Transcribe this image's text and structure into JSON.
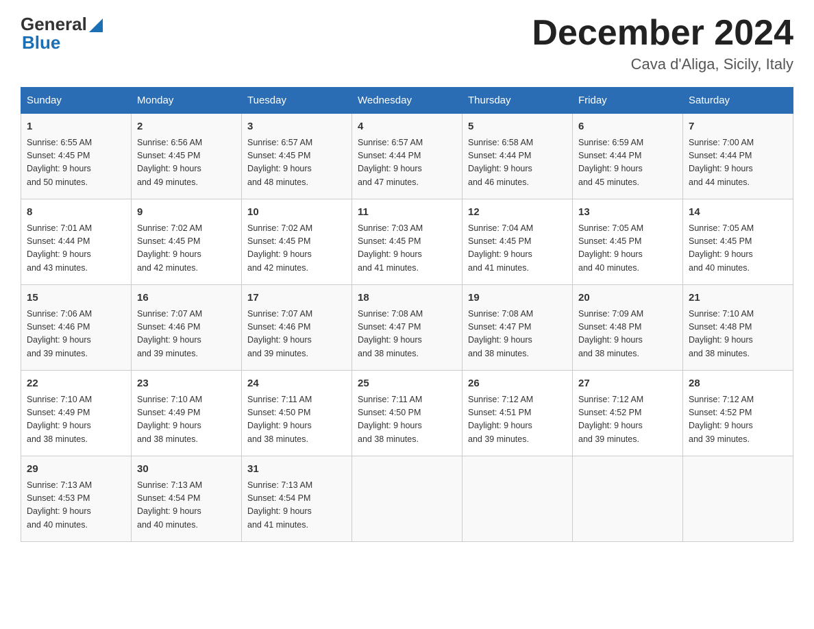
{
  "header": {
    "logo_general": "General",
    "logo_blue": "Blue",
    "month_title": "December 2024",
    "location": "Cava d'Aliga, Sicily, Italy"
  },
  "weekdays": [
    "Sunday",
    "Monday",
    "Tuesday",
    "Wednesday",
    "Thursday",
    "Friday",
    "Saturday"
  ],
  "weeks": [
    [
      {
        "day": "1",
        "sunrise": "6:55 AM",
        "sunset": "4:45 PM",
        "daylight": "9 hours and 50 minutes."
      },
      {
        "day": "2",
        "sunrise": "6:56 AM",
        "sunset": "4:45 PM",
        "daylight": "9 hours and 49 minutes."
      },
      {
        "day": "3",
        "sunrise": "6:57 AM",
        "sunset": "4:45 PM",
        "daylight": "9 hours and 48 minutes."
      },
      {
        "day": "4",
        "sunrise": "6:57 AM",
        "sunset": "4:44 PM",
        "daylight": "9 hours and 47 minutes."
      },
      {
        "day": "5",
        "sunrise": "6:58 AM",
        "sunset": "4:44 PM",
        "daylight": "9 hours and 46 minutes."
      },
      {
        "day": "6",
        "sunrise": "6:59 AM",
        "sunset": "4:44 PM",
        "daylight": "9 hours and 45 minutes."
      },
      {
        "day": "7",
        "sunrise": "7:00 AM",
        "sunset": "4:44 PM",
        "daylight": "9 hours and 44 minutes."
      }
    ],
    [
      {
        "day": "8",
        "sunrise": "7:01 AM",
        "sunset": "4:44 PM",
        "daylight": "9 hours and 43 minutes."
      },
      {
        "day": "9",
        "sunrise": "7:02 AM",
        "sunset": "4:45 PM",
        "daylight": "9 hours and 42 minutes."
      },
      {
        "day": "10",
        "sunrise": "7:02 AM",
        "sunset": "4:45 PM",
        "daylight": "9 hours and 42 minutes."
      },
      {
        "day": "11",
        "sunrise": "7:03 AM",
        "sunset": "4:45 PM",
        "daylight": "9 hours and 41 minutes."
      },
      {
        "day": "12",
        "sunrise": "7:04 AM",
        "sunset": "4:45 PM",
        "daylight": "9 hours and 41 minutes."
      },
      {
        "day": "13",
        "sunrise": "7:05 AM",
        "sunset": "4:45 PM",
        "daylight": "9 hours and 40 minutes."
      },
      {
        "day": "14",
        "sunrise": "7:05 AM",
        "sunset": "4:45 PM",
        "daylight": "9 hours and 40 minutes."
      }
    ],
    [
      {
        "day": "15",
        "sunrise": "7:06 AM",
        "sunset": "4:46 PM",
        "daylight": "9 hours and 39 minutes."
      },
      {
        "day": "16",
        "sunrise": "7:07 AM",
        "sunset": "4:46 PM",
        "daylight": "9 hours and 39 minutes."
      },
      {
        "day": "17",
        "sunrise": "7:07 AM",
        "sunset": "4:46 PM",
        "daylight": "9 hours and 39 minutes."
      },
      {
        "day": "18",
        "sunrise": "7:08 AM",
        "sunset": "4:47 PM",
        "daylight": "9 hours and 38 minutes."
      },
      {
        "day": "19",
        "sunrise": "7:08 AM",
        "sunset": "4:47 PM",
        "daylight": "9 hours and 38 minutes."
      },
      {
        "day": "20",
        "sunrise": "7:09 AM",
        "sunset": "4:48 PM",
        "daylight": "9 hours and 38 minutes."
      },
      {
        "day": "21",
        "sunrise": "7:10 AM",
        "sunset": "4:48 PM",
        "daylight": "9 hours and 38 minutes."
      }
    ],
    [
      {
        "day": "22",
        "sunrise": "7:10 AM",
        "sunset": "4:49 PM",
        "daylight": "9 hours and 38 minutes."
      },
      {
        "day": "23",
        "sunrise": "7:10 AM",
        "sunset": "4:49 PM",
        "daylight": "9 hours and 38 minutes."
      },
      {
        "day": "24",
        "sunrise": "7:11 AM",
        "sunset": "4:50 PM",
        "daylight": "9 hours and 38 minutes."
      },
      {
        "day": "25",
        "sunrise": "7:11 AM",
        "sunset": "4:50 PM",
        "daylight": "9 hours and 38 minutes."
      },
      {
        "day": "26",
        "sunrise": "7:12 AM",
        "sunset": "4:51 PM",
        "daylight": "9 hours and 39 minutes."
      },
      {
        "day": "27",
        "sunrise": "7:12 AM",
        "sunset": "4:52 PM",
        "daylight": "9 hours and 39 minutes."
      },
      {
        "day": "28",
        "sunrise": "7:12 AM",
        "sunset": "4:52 PM",
        "daylight": "9 hours and 39 minutes."
      }
    ],
    [
      {
        "day": "29",
        "sunrise": "7:13 AM",
        "sunset": "4:53 PM",
        "daylight": "9 hours and 40 minutes."
      },
      {
        "day": "30",
        "sunrise": "7:13 AM",
        "sunset": "4:54 PM",
        "daylight": "9 hours and 40 minutes."
      },
      {
        "day": "31",
        "sunrise": "7:13 AM",
        "sunset": "4:54 PM",
        "daylight": "9 hours and 41 minutes."
      },
      null,
      null,
      null,
      null
    ]
  ],
  "labels": {
    "sunrise": "Sunrise:",
    "sunset": "Sunset:",
    "daylight": "Daylight:"
  }
}
